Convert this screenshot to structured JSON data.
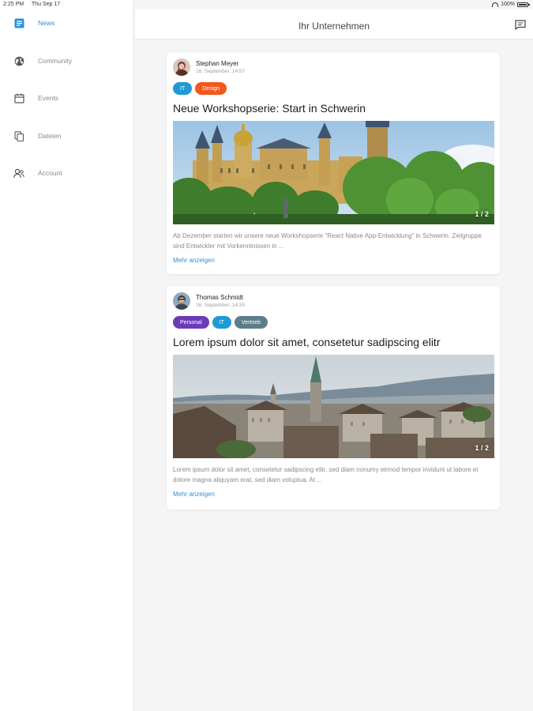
{
  "status_bar": {
    "time": "2:25 PM",
    "date": "Thu Sep 17",
    "battery": "100%"
  },
  "sidebar": {
    "items": [
      {
        "label": "News",
        "icon": "news-icon",
        "active": true
      },
      {
        "label": "Community",
        "icon": "globe-icon",
        "active": false
      },
      {
        "label": "Events",
        "icon": "calendar-icon",
        "active": false
      },
      {
        "label": "Dateien",
        "icon": "files-icon",
        "active": false
      },
      {
        "label": "Account",
        "icon": "account-icon",
        "active": false
      }
    ]
  },
  "header": {
    "title": "Ihr Unternehmen",
    "action_icon": "message-icon"
  },
  "colors": {
    "accent": "#2f8fd8",
    "tag_it": "#1f9ad6",
    "tag_design": "#f2581e",
    "tag_personal": "#6c3ab8",
    "tag_vertrieb": "#5d7d8a"
  },
  "posts": [
    {
      "author": "Stephan Meyer",
      "date": "16. September, 14:57",
      "tags": [
        "IT",
        "Design"
      ],
      "title": "Neue Workshopserie: Start in Schwerin",
      "image_counter": "1 / 2",
      "excerpt": "Ab Dezember starten wir unsere neue Workshopserie \"React Native App-Entwicklung\" in Schwerin. Zielgruppe sind Entwickler mit Vorkenntnissen in ...",
      "more": "Mehr anzeigen"
    },
    {
      "author": "Thomas Schmidt",
      "date": "16. September, 14:35",
      "tags": [
        "Personal",
        "IT",
        "Vertrieb"
      ],
      "title": "Lorem ipsum dolor sit amet, consetetur sadipscing elitr",
      "image_counter": "1 / 2",
      "excerpt": "Lorem ipsum dolor sit amet, consetetur sadipscing elitr, sed diam nonumy eirmod tempor invidunt ut labore et dolore magna aliquyam erat, sed diam voluptua. At ...",
      "more": "Mehr anzeigen"
    }
  ]
}
